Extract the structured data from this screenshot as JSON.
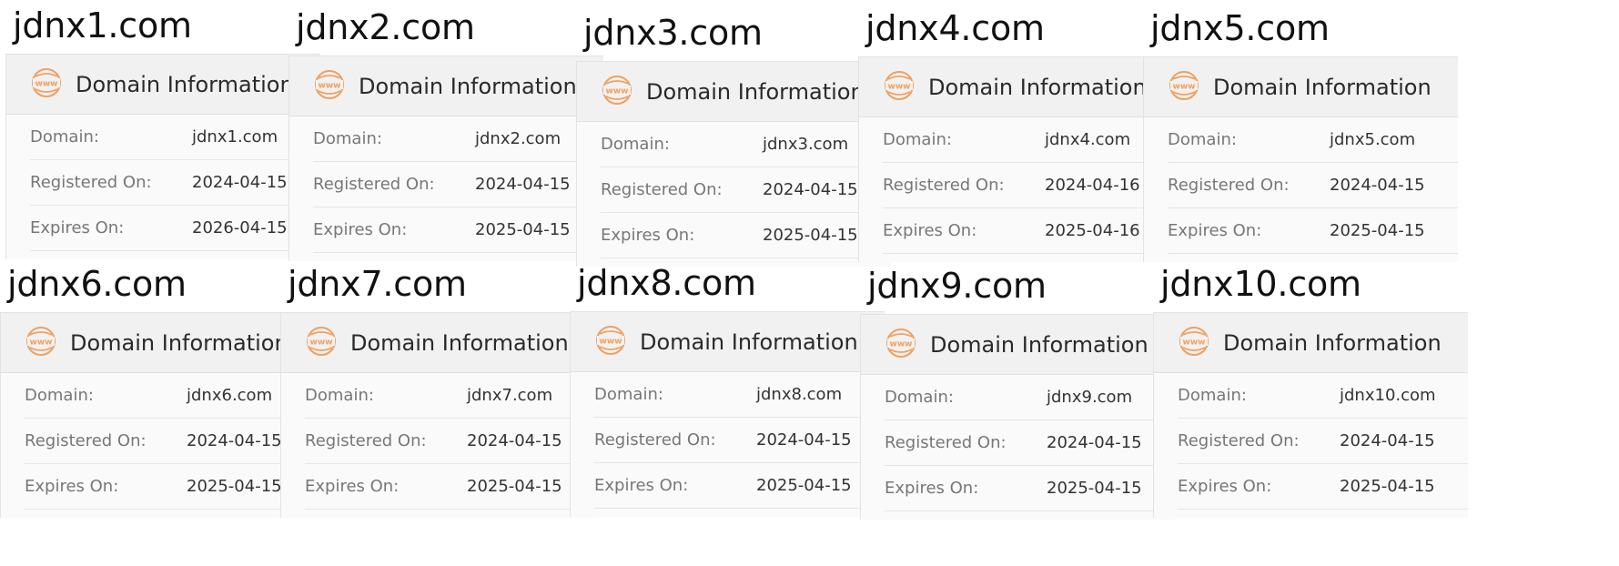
{
  "card_title": "Domain Information",
  "labels": {
    "domain": "Domain:",
    "registered": "Registered On:",
    "expires": "Expires On:"
  },
  "colors": {
    "accent": "#f0a060",
    "header_bg": "#f1f1f1",
    "card_bg": "#fafafa"
  },
  "icon": "www-globe-icon",
  "domains": [
    {
      "name": "jdnx1.com",
      "domain": "jdnx1.com",
      "registered": "2024-04-15",
      "expires": "2026-04-15"
    },
    {
      "name": "jdnx2.com",
      "domain": "jdnx2.com",
      "registered": "2024-04-15",
      "expires": "2025-04-15"
    },
    {
      "name": "jdnx3.com",
      "domain": "jdnx3.com",
      "registered": "2024-04-15",
      "expires": "2025-04-15"
    },
    {
      "name": "jdnx4.com",
      "domain": "jdnx4.com",
      "registered": "2024-04-16",
      "expires": "2025-04-16"
    },
    {
      "name": "jdnx5.com",
      "domain": "jdnx5.com",
      "registered": "2024-04-15",
      "expires": "2025-04-15"
    },
    {
      "name": "jdnx6.com",
      "domain": "jdnx6.com",
      "registered": "2024-04-15",
      "expires": "2025-04-15"
    },
    {
      "name": "jdnx7.com",
      "domain": "jdnx7.com",
      "registered": "2024-04-15",
      "expires": "2025-04-15"
    },
    {
      "name": "jdnx8.com",
      "domain": "jdnx8.com",
      "registered": "2024-04-15",
      "expires": "2025-04-15"
    },
    {
      "name": "jdnx9.com",
      "domain": "jdnx9.com",
      "registered": "2024-04-15",
      "expires": "2025-04-15"
    },
    {
      "name": "jdnx10.com",
      "domain": "jdnx10.com",
      "registered": "2024-04-15",
      "expires": "2025-04-15"
    }
  ]
}
